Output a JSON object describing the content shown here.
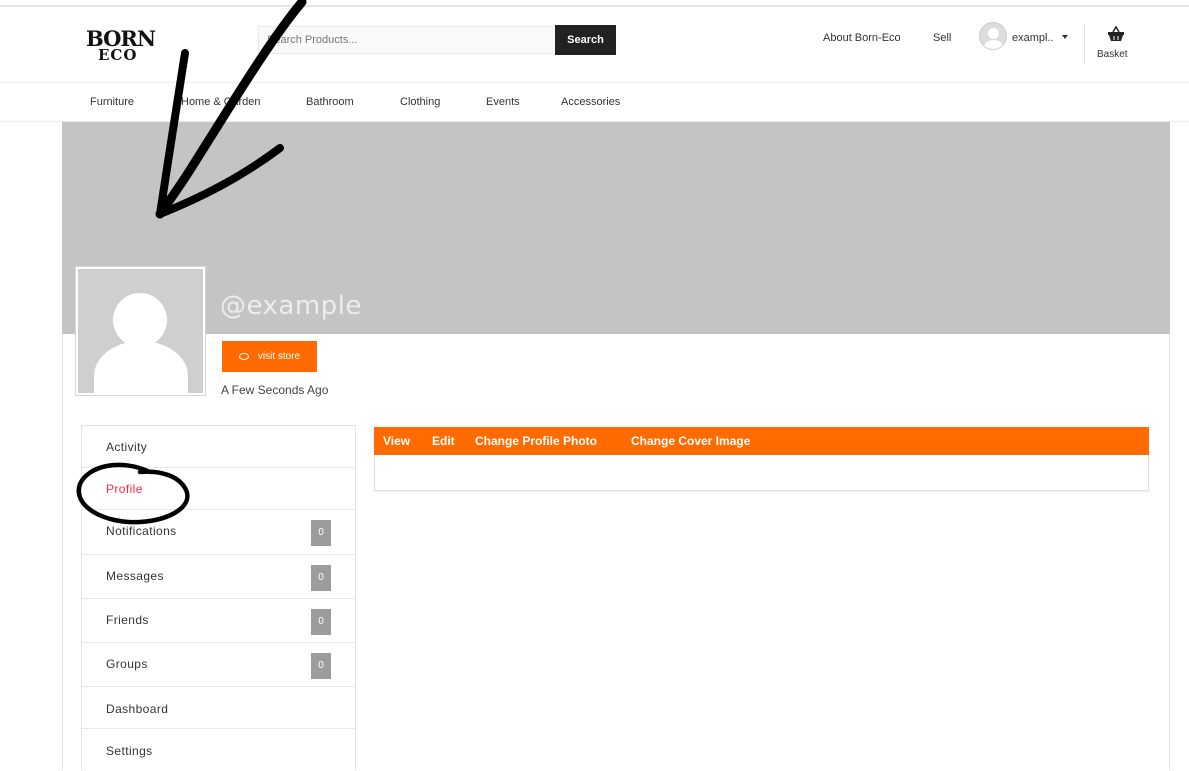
{
  "header": {
    "logo_line1": "BORN",
    "logo_line2": "ECO",
    "search_placeholder": "Search Products...",
    "search_button": "Search",
    "about_link": "About Born-Eco",
    "sell_link": "Sell",
    "user_name": "exampl..",
    "basket_label": "Basket",
    "icons": {
      "avatar": "user-avatar-icon",
      "caret": "caret-down-icon",
      "basket": "basket-icon"
    }
  },
  "nav": {
    "items": [
      "Furniture",
      "Home & Garden",
      "Bathroom",
      "Clothing",
      "Events",
      "Accessories"
    ]
  },
  "profile": {
    "username": "@example",
    "visit_store": "visit store",
    "time_ago": "A Few Seconds Ago"
  },
  "sidebar": {
    "items": [
      {
        "label": "Activity"
      },
      {
        "label": "Profile"
      },
      {
        "label": "Notifications",
        "count": "0"
      },
      {
        "label": "Messages",
        "count": "0"
      },
      {
        "label": "Friends",
        "count": "0"
      },
      {
        "label": "Groups",
        "count": "0"
      },
      {
        "label": "Dashboard"
      },
      {
        "label": "Settings"
      }
    ],
    "active_index": 1
  },
  "panel": {
    "tabs": [
      "View",
      "Edit",
      "Change Profile Photo",
      "Change Cover Image"
    ]
  },
  "colors": {
    "accent": "#ff6b00",
    "active_link": "#ff2a3d",
    "cover": "#c4c4c4",
    "dark_button": "#222222"
  }
}
